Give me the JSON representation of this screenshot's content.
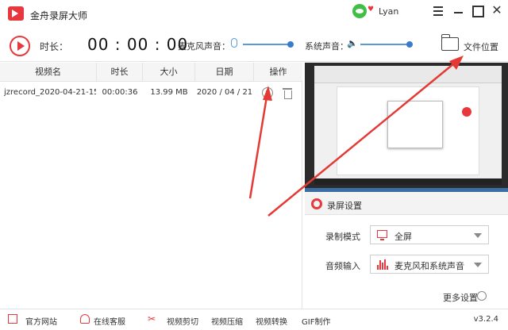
{
  "app": {
    "title": "金舟录屏大师",
    "user": "Lyan"
  },
  "toolbar": {
    "duration_label": "时长：",
    "timer": "00 : 00 : 00",
    "mic_label": "麦克风声音：",
    "system_label": "系统声音：",
    "file_location": "文件位置"
  },
  "table": {
    "headers": [
      "视频名",
      "时长",
      "大小",
      "日期",
      "操作"
    ],
    "rows": [
      {
        "name": "jzrecord_2020-04-21-15...",
        "duration": "00:00:36",
        "size": "13.99 MB",
        "date": "2020 / 04 / 21"
      }
    ]
  },
  "settings": {
    "title": "录屏设置",
    "mode_label": "录制模式",
    "mode_value": "全屏",
    "audio_label": "音频输入",
    "audio_value": "麦克风和系统声音",
    "more": "更多设置"
  },
  "footer": {
    "official_site": "官方网站",
    "online_service": "在线客服",
    "video_cut": "视频剪切",
    "video_compress": "视频压缩",
    "video_convert": "视频转换",
    "gif": "GIF制作",
    "version": "v3.2.4"
  },
  "colors": {
    "accent": "#e8383d",
    "slider": "#5b9bd5",
    "arrow": "#e53935"
  }
}
